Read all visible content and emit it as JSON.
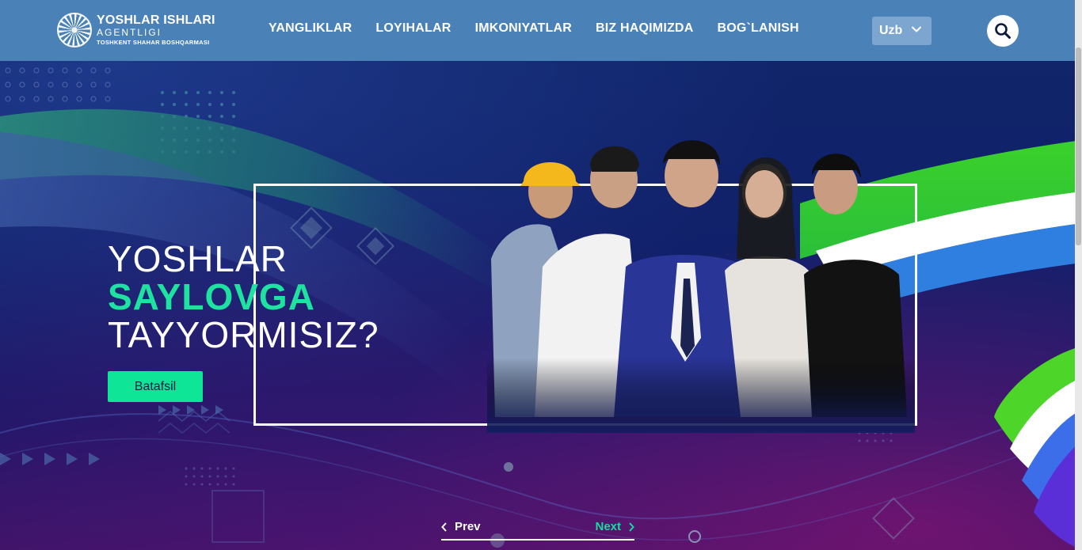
{
  "header": {
    "logo": {
      "title": "YOSHLAR ISHLARI",
      "subtitle": "AGENTLIGI",
      "subtitle2": "TOSHKENT SHAHAR BOSHQARMASI"
    },
    "nav": [
      {
        "label": "YANGLIKLAR"
      },
      {
        "label": "LOYIHALAR"
      },
      {
        "label": "IMKONIYATLAR"
      },
      {
        "label": "BIZ HAQIMIZDA"
      },
      {
        "label": "BOG`LANISH"
      }
    ],
    "language": {
      "selected": "Uzb"
    },
    "search_icon": "search-icon"
  },
  "hero": {
    "line1": "YOSHLAR",
    "line2": "SAYLOVGA",
    "line3": "TAYYORMISIZ?",
    "cta_label": "Batafsil",
    "colors": {
      "accent": "#1de2a0",
      "button": "#0ee596",
      "header": "#4a82b8"
    }
  },
  "slider": {
    "prev_label": "Prev",
    "next_label": "Next"
  }
}
